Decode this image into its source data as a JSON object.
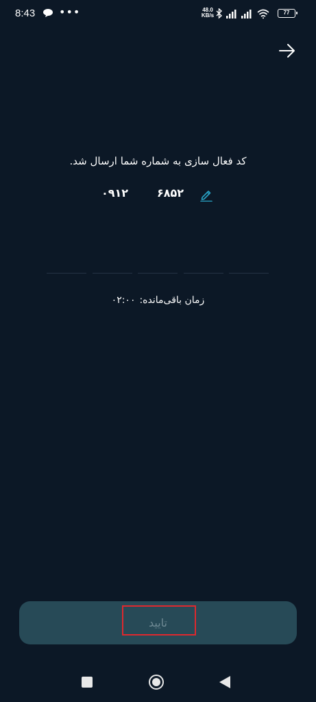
{
  "status_bar": {
    "time": "8:43",
    "more": "•••",
    "network_speed_value": "48.0",
    "network_speed_unit": "KB/s",
    "battery": "77"
  },
  "verification": {
    "message": "کد فعال سازی به شماره شما ارسال شد.",
    "phone_prefix": "۰۹۱۲",
    "phone_suffix": "۶۸۵۲"
  },
  "otp": {
    "digits": [
      "",
      "",
      "",
      "",
      ""
    ]
  },
  "timer": {
    "label": "زمان باقی‌مانده:",
    "value": "۰۲:۰۰"
  },
  "confirm": {
    "label": "تایید"
  },
  "colors": {
    "background": "#0c1826",
    "button": "#274a57",
    "button_text": "#6f8a94",
    "accent": "#29a3c6",
    "highlight": "#e0282d"
  },
  "icons": {
    "back": "arrow-right-icon",
    "edit": "pencil-icon",
    "chat": "chat-bubble-icon"
  }
}
